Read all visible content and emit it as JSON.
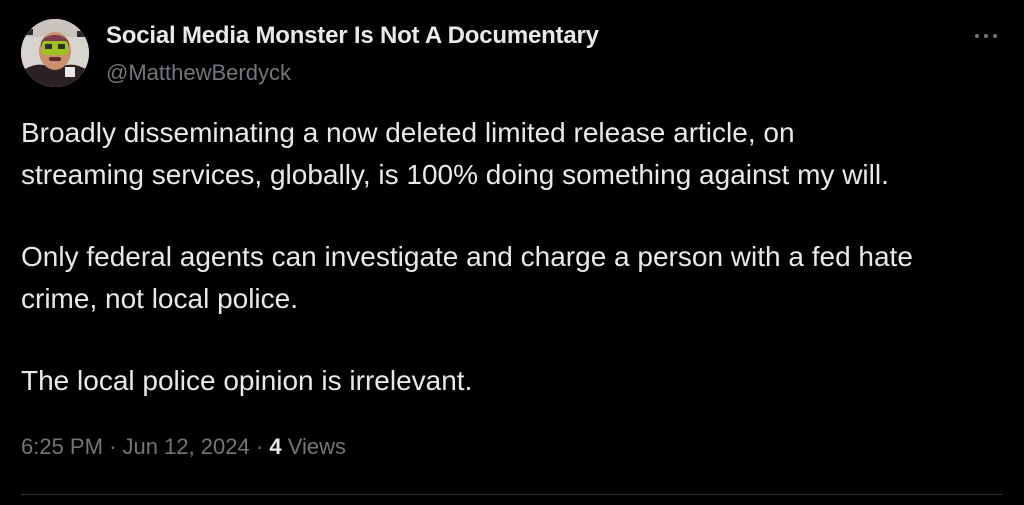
{
  "tweet": {
    "author": {
      "display_name": "Social Media Monster Is Not A Documentary",
      "handle": "@MatthewBerdyck",
      "avatar_icon": "avatar-image"
    },
    "more_icon": "more-options-icon",
    "paragraphs": [
      "Broadly disseminating a now deleted limited release article, on\nstreaming services, globally, is 100% doing something against my will.",
      "Only federal agents can investigate and charge a person with a fed hate\ncrime, not local police.",
      "The local police opinion is irrelevant."
    ],
    "meta": {
      "time": "6:25 PM",
      "separator": "·",
      "date": "Jun 12, 2024",
      "views_count": "4",
      "views_label": "Views"
    }
  },
  "colors": {
    "background": "#000000",
    "primary_text": "#e7e9ea",
    "secondary_text": "#71767b",
    "divider": "#2f3336"
  }
}
